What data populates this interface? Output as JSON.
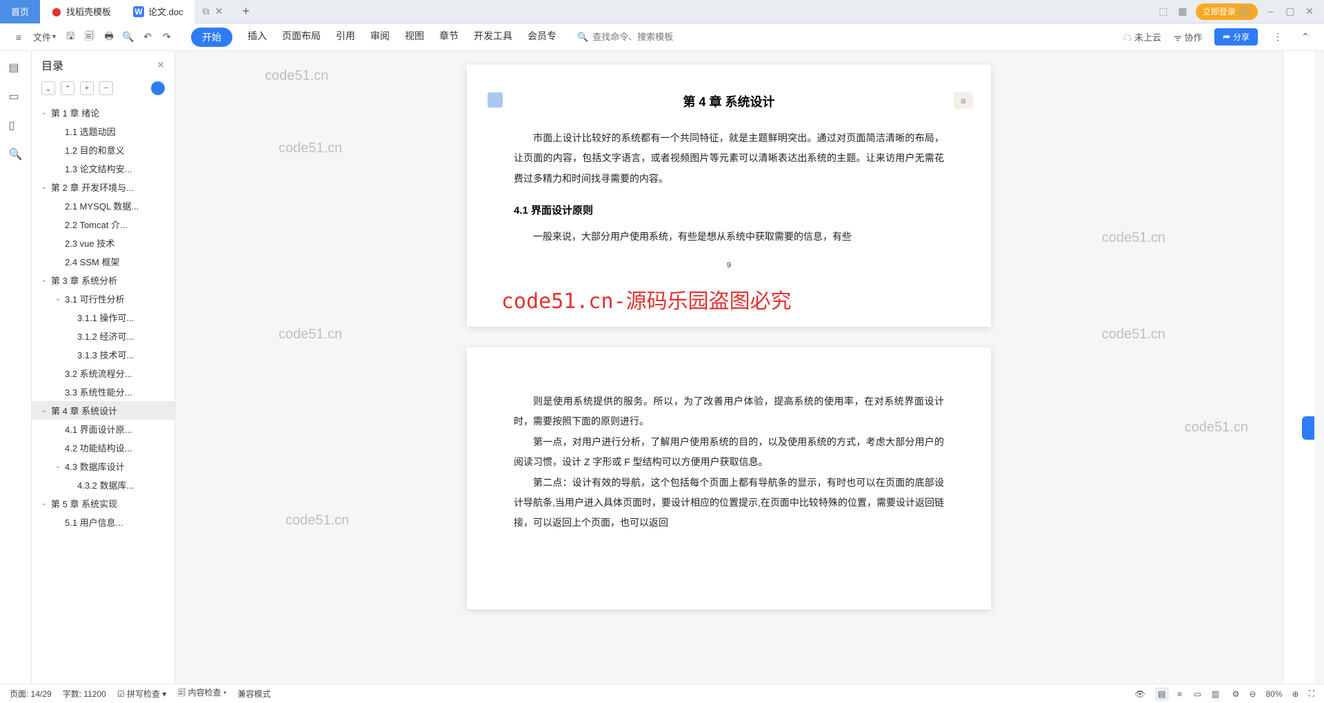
{
  "tabs": {
    "home": "首页",
    "template": "找稻壳模板",
    "doc": "论文.doc"
  },
  "login_label": "立即登录",
  "toolbar": {
    "file": "文件"
  },
  "ribbon": [
    "开始",
    "插入",
    "页面布局",
    "引用",
    "审阅",
    "视图",
    "章节",
    "开发工具",
    "会员专"
  ],
  "search_placeholder": "查找命令、搜索模板",
  "cloud": "未上云",
  "collab": "协作",
  "share": "分享",
  "outline": {
    "title": "目录",
    "items": [
      {
        "l": 1,
        "c": true,
        "t": "第 1 章 绪论"
      },
      {
        "l": 2,
        "t": "1.1 选题动因"
      },
      {
        "l": 2,
        "t": "1.2 目的和意义"
      },
      {
        "l": 2,
        "t": "1.3 论文结构安..."
      },
      {
        "l": 1,
        "c": true,
        "t": "第 2 章 开发环境与..."
      },
      {
        "l": 2,
        "t": "2.1 MYSQL 数据..."
      },
      {
        "l": 2,
        "t": "2.2 Tomcat 介..."
      },
      {
        "l": 2,
        "t": "2.3 vue 技术"
      },
      {
        "l": 2,
        "t": "2.4 SSM 框架"
      },
      {
        "l": 1,
        "c": true,
        "t": "第 3 章 系统分析"
      },
      {
        "l": 2,
        "c": true,
        "t": "3.1 可行性分析"
      },
      {
        "l": 3,
        "t": "3.1.1 操作可..."
      },
      {
        "l": 3,
        "t": "3.1.2 经济可..."
      },
      {
        "l": 3,
        "t": "3.1.3 技术可..."
      },
      {
        "l": 2,
        "t": "3.2 系统流程分..."
      },
      {
        "l": 2,
        "t": "3.3 系统性能分..."
      },
      {
        "l": 1,
        "c": true,
        "t": "第 4 章  系统设计",
        "sel": true
      },
      {
        "l": 2,
        "t": "4.1 界面设计原..."
      },
      {
        "l": 2,
        "t": "4.2 功能结构设..."
      },
      {
        "l": 2,
        "c": true,
        "t": "4.3 数据库设计"
      },
      {
        "l": 3,
        "t": "4.3.2 数据库..."
      },
      {
        "l": 1,
        "c": true,
        "t": "第 5 章  系统实现"
      },
      {
        "l": 2,
        "t": "5.1 用户信息..."
      }
    ]
  },
  "doc": {
    "chapter_title": "第 4 章  系统设计",
    "para1": "市面上设计比较好的系统都有一个共同特征，就是主题鲜明突出。通过对页面简洁清晰的布局，让页面的内容，包括文字语言，或者视频图片等元素可以清晰表达出系统的主题。让来访用户无需花费过多精力和时间找寻需要的内容。",
    "h3_1": "4.1 界面设计原则",
    "para2": "一般来说，大部分用户使用系统，有些是想从系统中获取需要的信息，有些",
    "page_num": "9",
    "para3": "则是使用系统提供的服务。所以，为了改善用户体验，提高系统的使用率，在对系统界面设计时，需要按照下面的原则进行。",
    "para4": "第一点，对用户进行分析，了解用户使用系统的目的，以及使用系统的方式，考虑大部分用户的阅读习惯，设计 Z 字形或 F 型结构可以方便用户获取信息。",
    "para5": "第二点：设计有效的导航，这个包括每个页面上都有导航条的显示，有时也可以在页面的底部设计导航条,当用户进入具体页面时，要设计相应的位置提示,在页面中比较特殊的位置，需要设计返回链接，可以返回上个页面，也可以返回"
  },
  "watermarks": {
    "small": "code51.cn",
    "big": "code51.cn-源码乐园盗图必究"
  },
  "status": {
    "page": "页面: 14/29",
    "words": "字数: 11200",
    "spell": "拼写检查",
    "content": "内容检查",
    "compat": "兼容模式",
    "zoom": "80%"
  }
}
